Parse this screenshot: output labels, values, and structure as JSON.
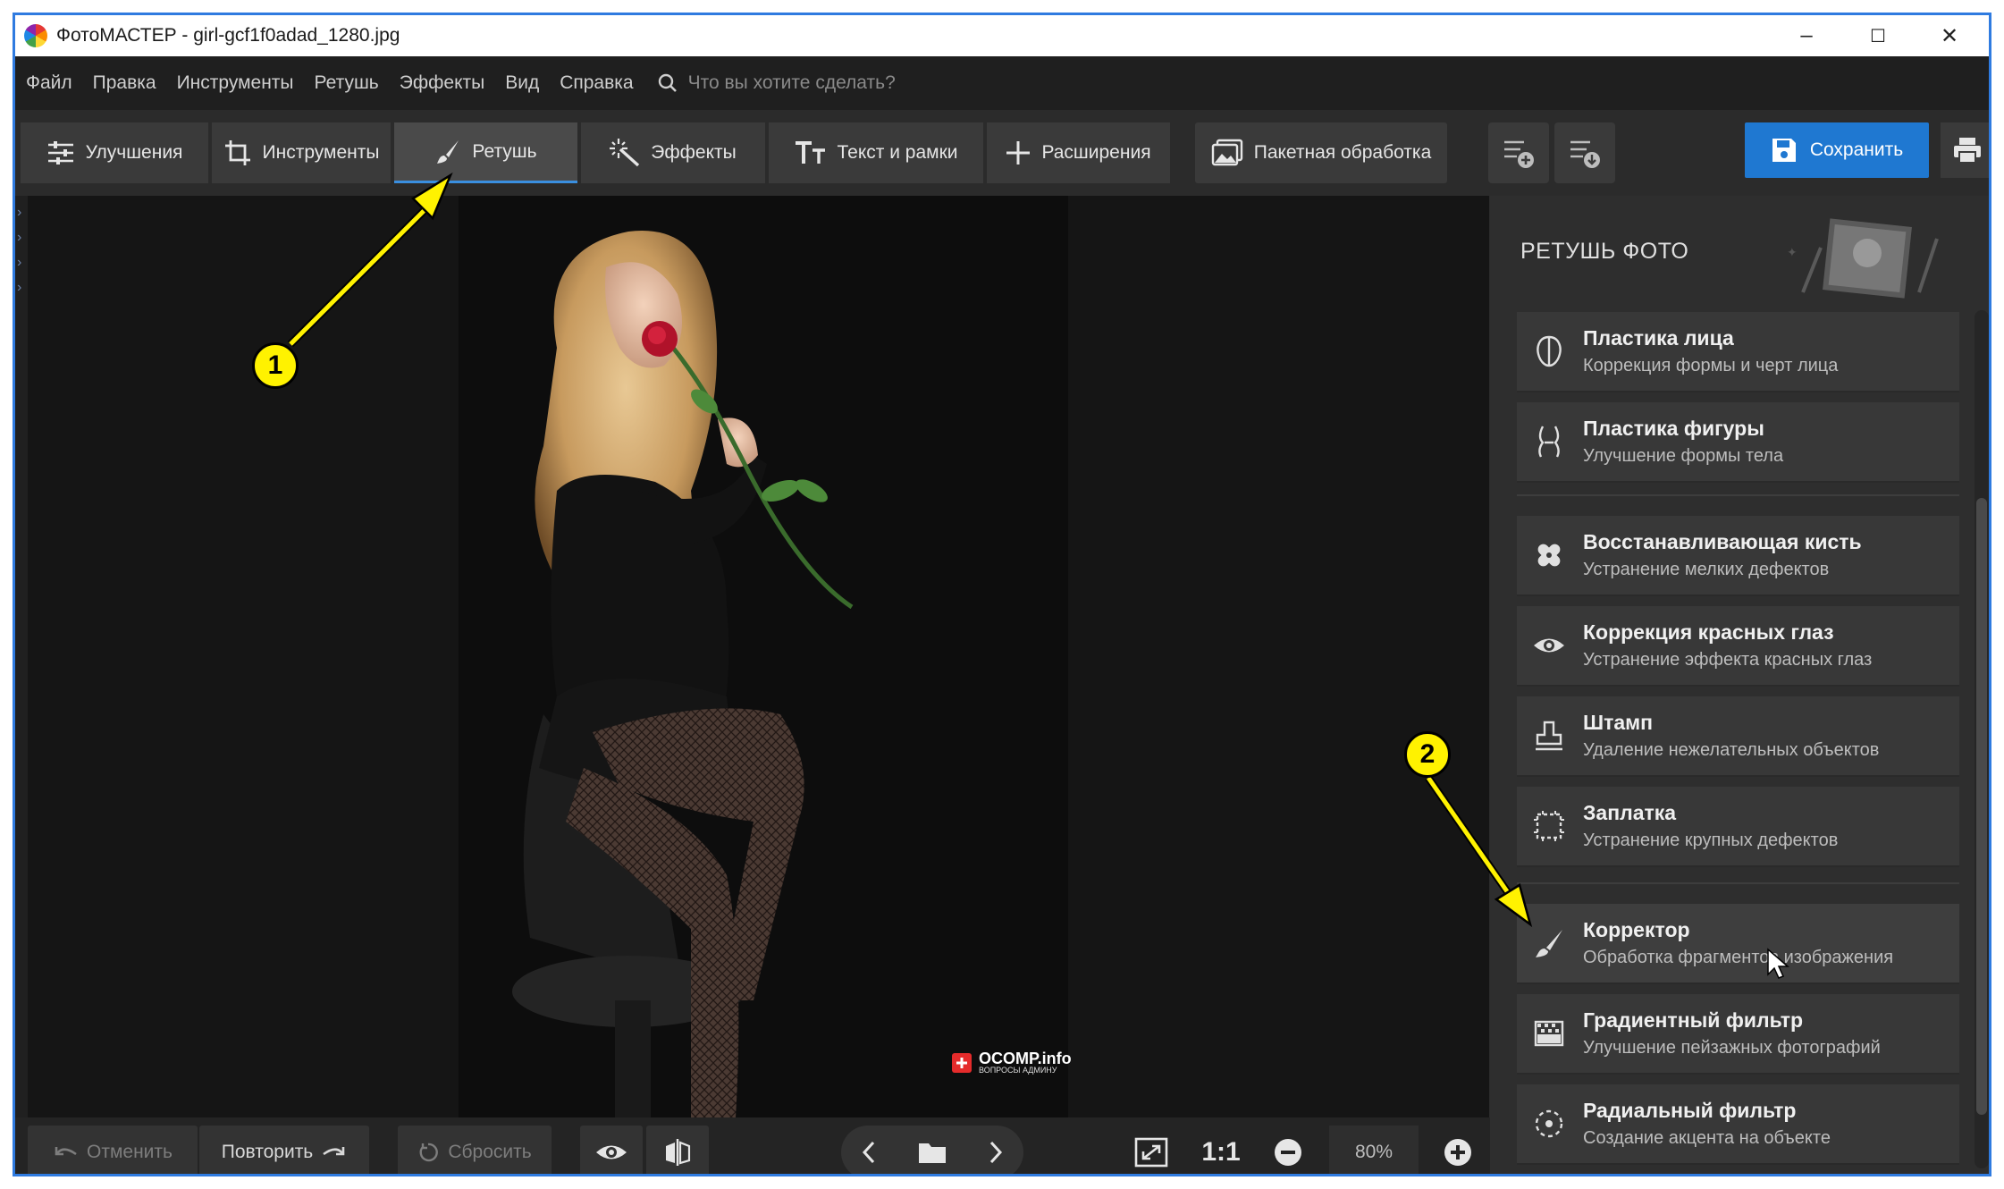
{
  "window": {
    "title": "ФотоМАСТЕР - girl-gcf1f0adad_1280.jpg",
    "controls": [
      "–",
      "☐",
      "✕"
    ]
  },
  "menu": {
    "items": [
      "Файл",
      "Правка",
      "Инструменты",
      "Ретушь",
      "Эффекты",
      "Вид",
      "Справка"
    ],
    "search_placeholder": "Что вы хотите сделать?"
  },
  "toolbar": {
    "tabs": [
      {
        "label": "Улучшения",
        "icon": "sliders-icon"
      },
      {
        "label": "Инструменты",
        "icon": "crop-icon"
      },
      {
        "label": "Ретушь",
        "icon": "brush-icon",
        "active": true
      },
      {
        "label": "Эффекты",
        "icon": "magic-wand-icon"
      },
      {
        "label": "Текст и рамки",
        "icon": "text-icon"
      },
      {
        "label": "Расширения",
        "icon": "plus-icon"
      },
      {
        "label": "Пакетная обработка",
        "icon": "images-icon"
      }
    ],
    "save_label": "Сохранить",
    "accent_color": "#1f78d1"
  },
  "panel": {
    "title": "РЕТУШЬ ФОТО",
    "tools": [
      {
        "title": "Пластика лица",
        "subtitle": "Коррекция формы и черт лица",
        "icon": "face-icon"
      },
      {
        "title": "Пластика фигуры",
        "subtitle": "Улучшение формы тела",
        "icon": "body-icon"
      },
      {
        "title": "Восстанавливающая кисть",
        "subtitle": "Устранение мелких дефектов",
        "icon": "bandage-icon"
      },
      {
        "title": "Коррекция красных глаз",
        "subtitle": "Устранение эффекта красных глаз",
        "icon": "eye-icon"
      },
      {
        "title": "Штамп",
        "subtitle": "Удаление нежелательных объектов",
        "icon": "stamp-icon"
      },
      {
        "title": "Заплатка",
        "subtitle": "Устранение крупных дефектов",
        "icon": "patch-icon"
      },
      {
        "title": "Корректор",
        "subtitle": "Обработка фрагментов изображения",
        "icon": "brush-icon"
      },
      {
        "title": "Градиентный фильтр",
        "subtitle": "Улучшение пейзажных фотографий",
        "icon": "gradient-icon"
      },
      {
        "title": "Радиальный фильтр",
        "subtitle": "Создание акцента на объекте",
        "icon": "radial-icon"
      }
    ]
  },
  "bottom": {
    "undo_label": "Отменить",
    "redo_label": "Повторить",
    "reset_label": "Сбросить",
    "ratio_label": "1:1",
    "zoom": "80%"
  },
  "watermark": {
    "name": "OCOMP.info",
    "tagline": "ВОПРОСЫ АДМИНУ"
  },
  "annotations": {
    "badge1": "1",
    "badge2": "2",
    "color": "#fff200"
  }
}
